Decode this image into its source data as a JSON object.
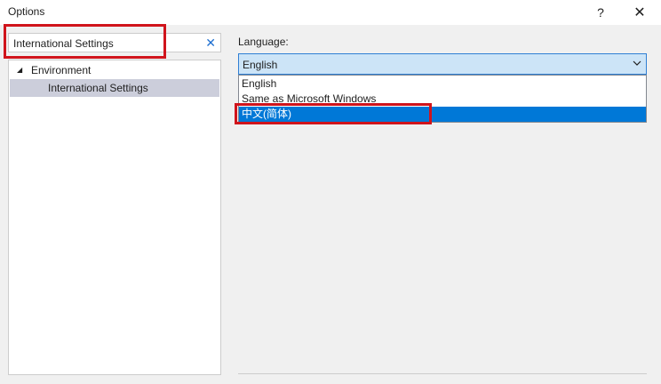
{
  "window": {
    "title": "Options",
    "help_glyph": "?",
    "close_glyph": "✕"
  },
  "search": {
    "value": "International Settings",
    "clear_glyph": "✕"
  },
  "tree": {
    "items": [
      {
        "label": "Environment",
        "expanded": true,
        "arrow_glyph": "◢"
      },
      {
        "label": "International Settings",
        "selected": true
      }
    ]
  },
  "language": {
    "label": "Language:",
    "selected_value": "English",
    "options": [
      {
        "label": "English"
      },
      {
        "label": "Same as Microsoft Windows"
      },
      {
        "label": "中文(简体)",
        "highlighted": true
      }
    ]
  },
  "colors": {
    "selection": "#0078d7",
    "combo_bg": "#cce4f7",
    "annotation_red": "#d0141c",
    "tree_selected": "#cccedb"
  }
}
